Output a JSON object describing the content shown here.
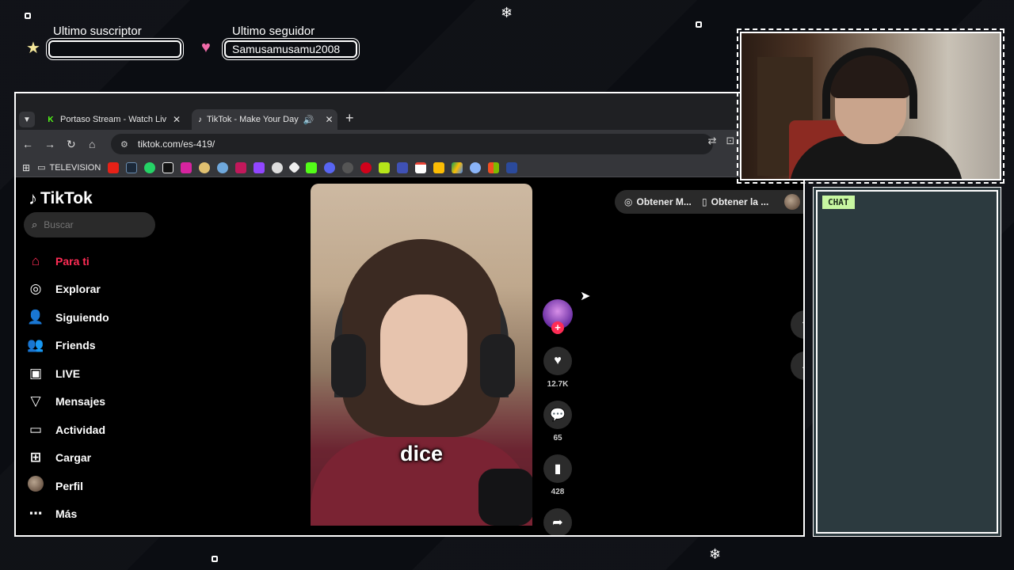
{
  "overlay": {
    "last_subscriber_label": "Ultimo suscriptor",
    "last_subscriber_value": "",
    "last_follower_label": "Ultimo seguidor",
    "last_follower_value": "Samusamusamu2008",
    "chat_label": "CHAT"
  },
  "browser": {
    "tabs": [
      {
        "title": "Portaso Stream - Watch Live on",
        "favicon": "kick-icon",
        "favicon_color": "#53fc18"
      },
      {
        "title": "TikTok - Make Your Day",
        "favicon": "tiktok-icon",
        "favicon_color": "#ffffff"
      }
    ],
    "url": "tiktok.com/es-419/",
    "bookmark_folder": "TELEVISION"
  },
  "tiktok": {
    "logo": "TikTok",
    "search_placeholder": "Buscar",
    "nav": [
      {
        "label": "Para ti",
        "icon": "home-icon",
        "active": true
      },
      {
        "label": "Explorar",
        "icon": "compass-icon",
        "active": false
      },
      {
        "label": "Siguiendo",
        "icon": "user-follow-icon",
        "active": false
      },
      {
        "label": "Friends",
        "icon": "friends-icon",
        "active": false
      },
      {
        "label": "LIVE",
        "icon": "live-icon",
        "active": false
      },
      {
        "label": "Mensajes",
        "icon": "send-icon",
        "active": false
      },
      {
        "label": "Actividad",
        "icon": "inbox-icon",
        "active": false
      },
      {
        "label": "Cargar",
        "icon": "upload-icon",
        "active": false
      },
      {
        "label": "Perfil",
        "icon": "avatar",
        "active": false
      },
      {
        "label": "Más",
        "icon": "more-icon",
        "active": false
      }
    ],
    "caption": "dice",
    "likes": "12.7K",
    "comments": "65",
    "saves": "428",
    "get_app_1": "Obtener M...",
    "get_app_2": "Obtener la ...",
    "accent": "#fe2c55"
  }
}
